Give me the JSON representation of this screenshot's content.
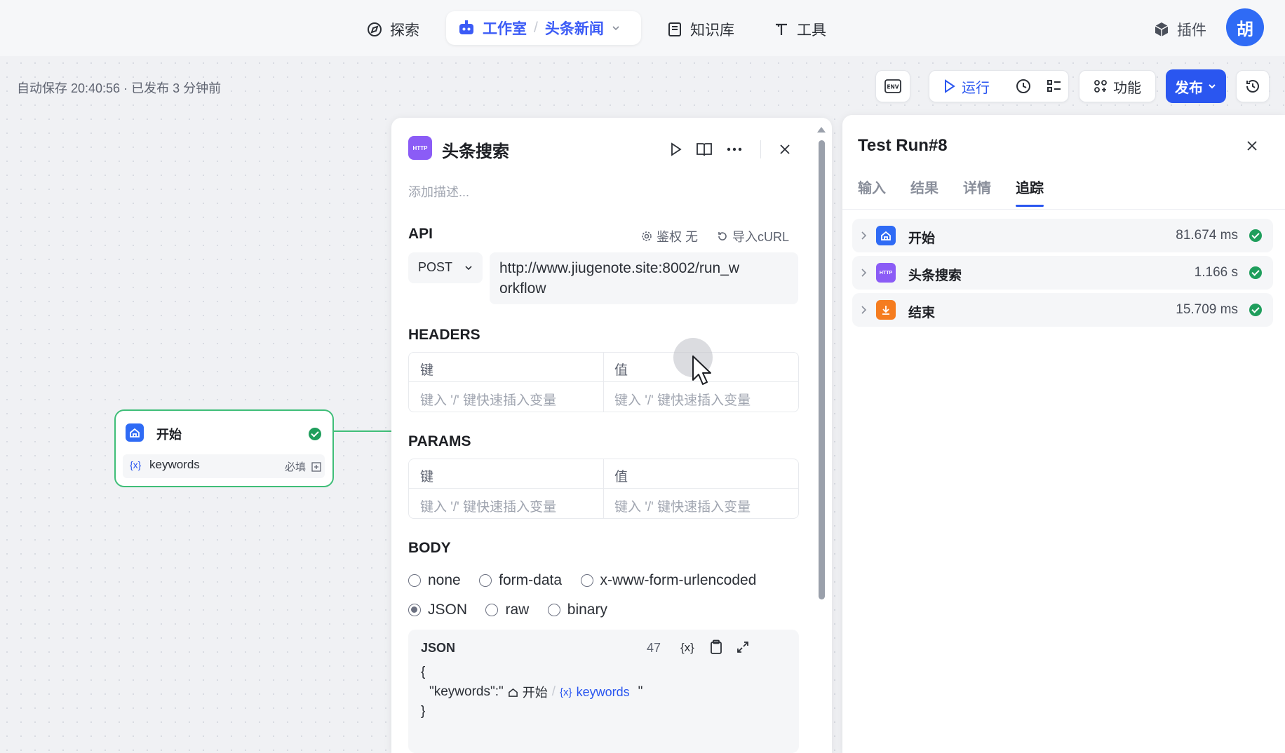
{
  "nav": {
    "explore": "探索",
    "studio": "工作室",
    "project": "头条新闻",
    "knowledge": "知识库",
    "tools": "工具",
    "plugins": "插件",
    "avatar": "胡"
  },
  "toolbar": {
    "autosave": "自动保存 20:40:56 · 已发布 3 分钟前",
    "env": "ENV",
    "run": "运行",
    "features": "功能",
    "publish": "发布"
  },
  "start_node": {
    "title": "开始",
    "var_name": "keywords",
    "required": "必填"
  },
  "panel": {
    "title": "头条搜索",
    "badge": "HTTP",
    "description_placeholder": "添加描述...",
    "api": {
      "label": "API",
      "auth": "鉴权 无",
      "import": "导入cURL",
      "method": "POST",
      "url_line1": "http://www.jiugenote.site:8002/run_w",
      "url_line2": "orkflow"
    },
    "headers": {
      "label": "HEADERS",
      "key": "键",
      "value": "值",
      "key_placeholder": "键入 '/' 键快速插入变量",
      "value_placeholder": "键入 '/' 键快速插入变量"
    },
    "params": {
      "label": "PARAMS",
      "key": "键",
      "value": "值",
      "key_placeholder": "键入 '/' 键快速插入变量",
      "value_placeholder": "键入 '/' 键快速插入变量"
    },
    "body": {
      "label": "BODY",
      "options": [
        "none",
        "form-data",
        "x-www-form-urlencoded",
        "JSON",
        "raw",
        "binary"
      ],
      "selected": "JSON",
      "editor_label": "JSON",
      "char_count": "47",
      "var_token": "{x}",
      "line_open": "{",
      "line_key": "\"keywords\":\"",
      "ref_node": "开始",
      "ref_var": "keywords",
      "line_quote": "\"",
      "line_close": "}"
    }
  },
  "testrun": {
    "title": "Test Run#8",
    "tabs": [
      "输入",
      "结果",
      "详情",
      "追踪"
    ],
    "active_tab": "追踪",
    "rows": [
      {
        "name": "开始",
        "time": "81.674 ms",
        "color": "#2f6bf5"
      },
      {
        "name": "头条搜索",
        "time": "1.166 s",
        "color": "#8b5cf6",
        "badge": "HTTP"
      },
      {
        "name": "结束",
        "time": "15.709 ms",
        "color": "#f57c1f"
      }
    ]
  },
  "colors": {
    "accent": "#2a56f0",
    "success": "#1f9e5c",
    "node_border": "#3fbe78"
  }
}
